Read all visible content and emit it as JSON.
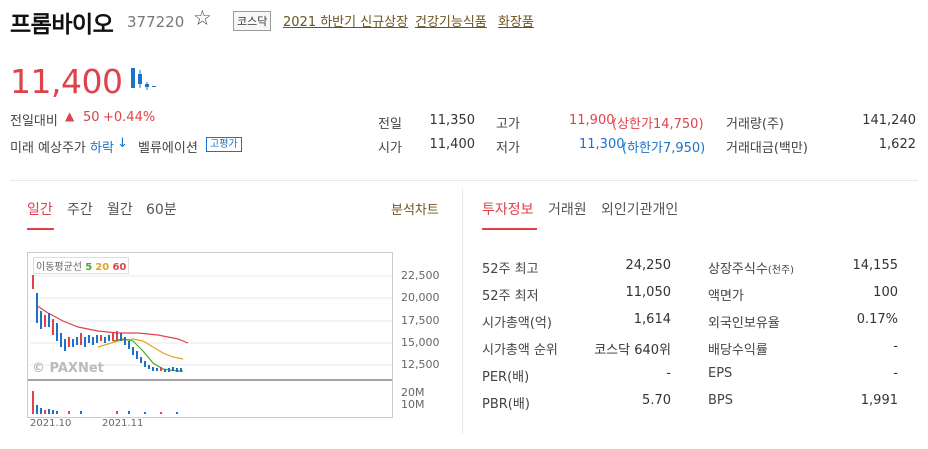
{
  "header": {
    "stock_name": "프롬바이오",
    "stock_code": "377220",
    "market_tag": "코스닥",
    "tags": [
      "2021 하반기 신규상장",
      "건강기능식품",
      "화장품"
    ]
  },
  "price": {
    "current": "11,400",
    "change_label": "전일대비",
    "change_arrow": "▲",
    "change_value": "50",
    "change_pct": "+0.44%",
    "future_label": "미래 예상주가",
    "future_value": "하락",
    "future_arrow": "↓",
    "valuation_label": "벨류에이션",
    "valuation_badge": "고평가"
  },
  "quote": {
    "prev_label": "전일",
    "prev_value": "11,350",
    "open_label": "시가",
    "open_value": "11,400",
    "high_label": "고가",
    "high_value": "11,900",
    "high_limit": "(상한가14,750)",
    "low_label": "저가",
    "low_value": "11,300",
    "low_limit": "(하한가7,950)",
    "volume_label": "거래량(주)",
    "volume_value": "141,240",
    "amount_label": "거래대금(백만)",
    "amount_value": "1,622"
  },
  "chart_tabs": [
    "일간",
    "주간",
    "월간",
    "60분"
  ],
  "analysis_link": "분석차트",
  "chart": {
    "ma_label": "이동평균선",
    "ma_5": "5",
    "ma_20": "20",
    "ma_60": "60",
    "y_ticks": [
      "22,500",
      "20,000",
      "17,500",
      "15,000",
      "12,500"
    ],
    "vol_ticks": [
      "20M",
      "10M"
    ],
    "x_ticks": [
      "2021.10",
      "2021.11"
    ],
    "watermark": "© PAXNet",
    "colors": {
      "ma5": "#44aa33",
      "ma20": "#e8a21f",
      "ma60": "#e0424c",
      "up": "#e0424c",
      "down": "#1a73c9"
    }
  },
  "info_tabs": [
    "투자정보",
    "거래원",
    "외인기관개인"
  ],
  "info_left": [
    {
      "label": "52주 최고",
      "value": "24,250"
    },
    {
      "label": "52주 최저",
      "value": "11,050"
    },
    {
      "label": "시가총액(억)",
      "value": "1,614"
    },
    {
      "label": "시가총액 순위",
      "value": "코스닥 640위"
    },
    {
      "label": "PER(배)",
      "value": "-"
    },
    {
      "label": "PBR(배)",
      "value": "5.70"
    }
  ],
  "info_right": [
    {
      "label": "상장주식수",
      "sub": "(천주)",
      "value": "14,155"
    },
    {
      "label": "액면가",
      "sub": "",
      "value": "100"
    },
    {
      "label": "외국인보유율",
      "sub": "",
      "value": "0.17%"
    },
    {
      "label": "배당수익률",
      "sub": "",
      "value": "-"
    },
    {
      "label": "EPS",
      "sub": "",
      "value": "-"
    },
    {
      "label": "BPS",
      "sub": "",
      "value": "1,991"
    }
  ]
}
